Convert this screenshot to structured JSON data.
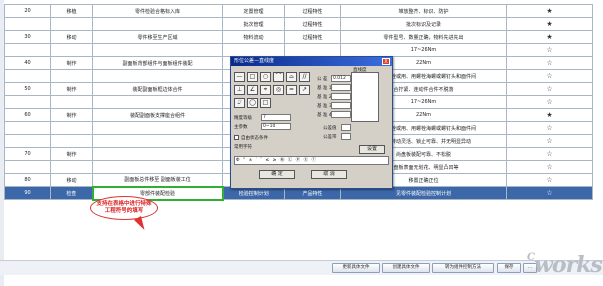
{
  "rows": [
    {
      "no": "20",
      "dept": "移植",
      "item": "零件检验合格标入库",
      "cat": "定置管理",
      "type": "过程特性",
      "desc": "堆放整齐、标识、防护",
      "star": "★"
    },
    {
      "no": "",
      "dept": "",
      "item": "",
      "cat": "批次管理",
      "type": "过程特性",
      "desc": "批次标识及记录",
      "star": "★"
    },
    {
      "no": "30",
      "dept": "移动",
      "item": "零件移至生产区域",
      "cat": "物料流动",
      "type": "过程特性",
      "desc": "零件型号、数量正确，物料先进先出",
      "star": "★"
    },
    {
      "no": "",
      "dept": "",
      "item": "",
      "cat": "",
      "type": "",
      "desc": "17~26Nm",
      "star": "☆"
    },
    {
      "no": "40",
      "dept": "制作",
      "item": "副面板背部组件与面板组件装配",
      "cat": "",
      "type": "",
      "desc": "22Nm",
      "star": "☆"
    },
    {
      "no": "",
      "dept": "",
      "item": "",
      "cat": "",
      "type": "",
      "desc": "手拧紧螺栓或用、用螺栓海螺或螺钉头和面件间",
      "star": "☆"
    },
    {
      "no": "50",
      "dept": "制作",
      "item": "装配副面板框边体合件",
      "cat": "",
      "type": "",
      "desc": "合拧紧、连动件合件不脱落",
      "star": "☆"
    },
    {
      "no": "",
      "dept": "",
      "item": "",
      "cat": "",
      "type": "",
      "desc": "17~26Nm",
      "star": "☆"
    },
    {
      "no": "60",
      "dept": "制作",
      "item": "装配副面板支撑座合组件",
      "cat": "",
      "type": "",
      "desc": "22Nm",
      "star": "★"
    },
    {
      "no": "",
      "dept": "",
      "item": "",
      "cat": "",
      "type": "",
      "desc": "手拧紧螺栓或用、用螺栓海螺或螺钉头和面件间",
      "star": "☆"
    },
    {
      "no": "",
      "dept": "",
      "item": "",
      "cat": "副面性能",
      "type": "产品特性",
      "desc": "副面板转动灵活、锁止可靠、并无明显异动",
      "star": "☆"
    },
    {
      "no": "70",
      "dept": "制作",
      "item": "",
      "cat": "装配",
      "type": "产品特性",
      "desc": "尚盘板装配可靠、不松脱",
      "star": "☆"
    },
    {
      "no": "",
      "dept": "",
      "item": "",
      "cat": "外观",
      "type": "产品特性",
      "desc": "尚盘板表面无划花、明显凸凹等",
      "star": "☆"
    },
    {
      "no": "80",
      "dept": "移动",
      "item": "副面板总件移至 副面板装工位",
      "cat": "移动",
      "type": "过程特性",
      "desc": "移置正确正位",
      "star": "☆"
    },
    {
      "no": "90",
      "dept": "检查",
      "item": "零部件装配检验",
      "cat": "检验控制计划",
      "type": "产品特性",
      "desc": "见零件装配检验控制计划",
      "star": "☆"
    }
  ],
  "callout": {
    "line1": "支持在表格中进行特殊",
    "line2": "工程符号的填写"
  },
  "bottom_buttons": [
    "更新具体文件",
    "创建具体文件",
    "转为组件控制方法",
    "保存",
    "..."
  ],
  "logo": {
    "main": "works",
    "prefix": "C"
  },
  "dialog": {
    "title": "形位公差—直线度",
    "close": "X",
    "symbols_row1": [
      "—",
      "□",
      "○",
      "⌒",
      "⌓",
      "//"
    ],
    "symbols_row2": [
      "⊥",
      "∠",
      "⌖",
      "◎",
      "=",
      "↗"
    ],
    "symbols_row3": [
      "⌰",
      "◯",
      "□"
    ],
    "label_grade": "精度等级",
    "value_grade": "7",
    "label_size": "主参数",
    "value_size": "0~10",
    "label_direct": "直线度",
    "label_tol": "公 差",
    "value_tol": "0.012",
    "label_base1": "基 准 1",
    "label_base2": "基 准 2",
    "label_base3": "基 准 3",
    "label_base4": "基 准 4",
    "label_qty1": "公差值",
    "label_qty2": "公差带",
    "check_label": "自由状态条件",
    "common_label": "常用字符",
    "common_chars": "Φ ° ± ′ ″ ≤ ≥ Ⓜ Ⓛ Ⓟ Ⓔ ⓕ",
    "set_label": "设置",
    "ok": "确 定",
    "cancel": "取 消"
  }
}
